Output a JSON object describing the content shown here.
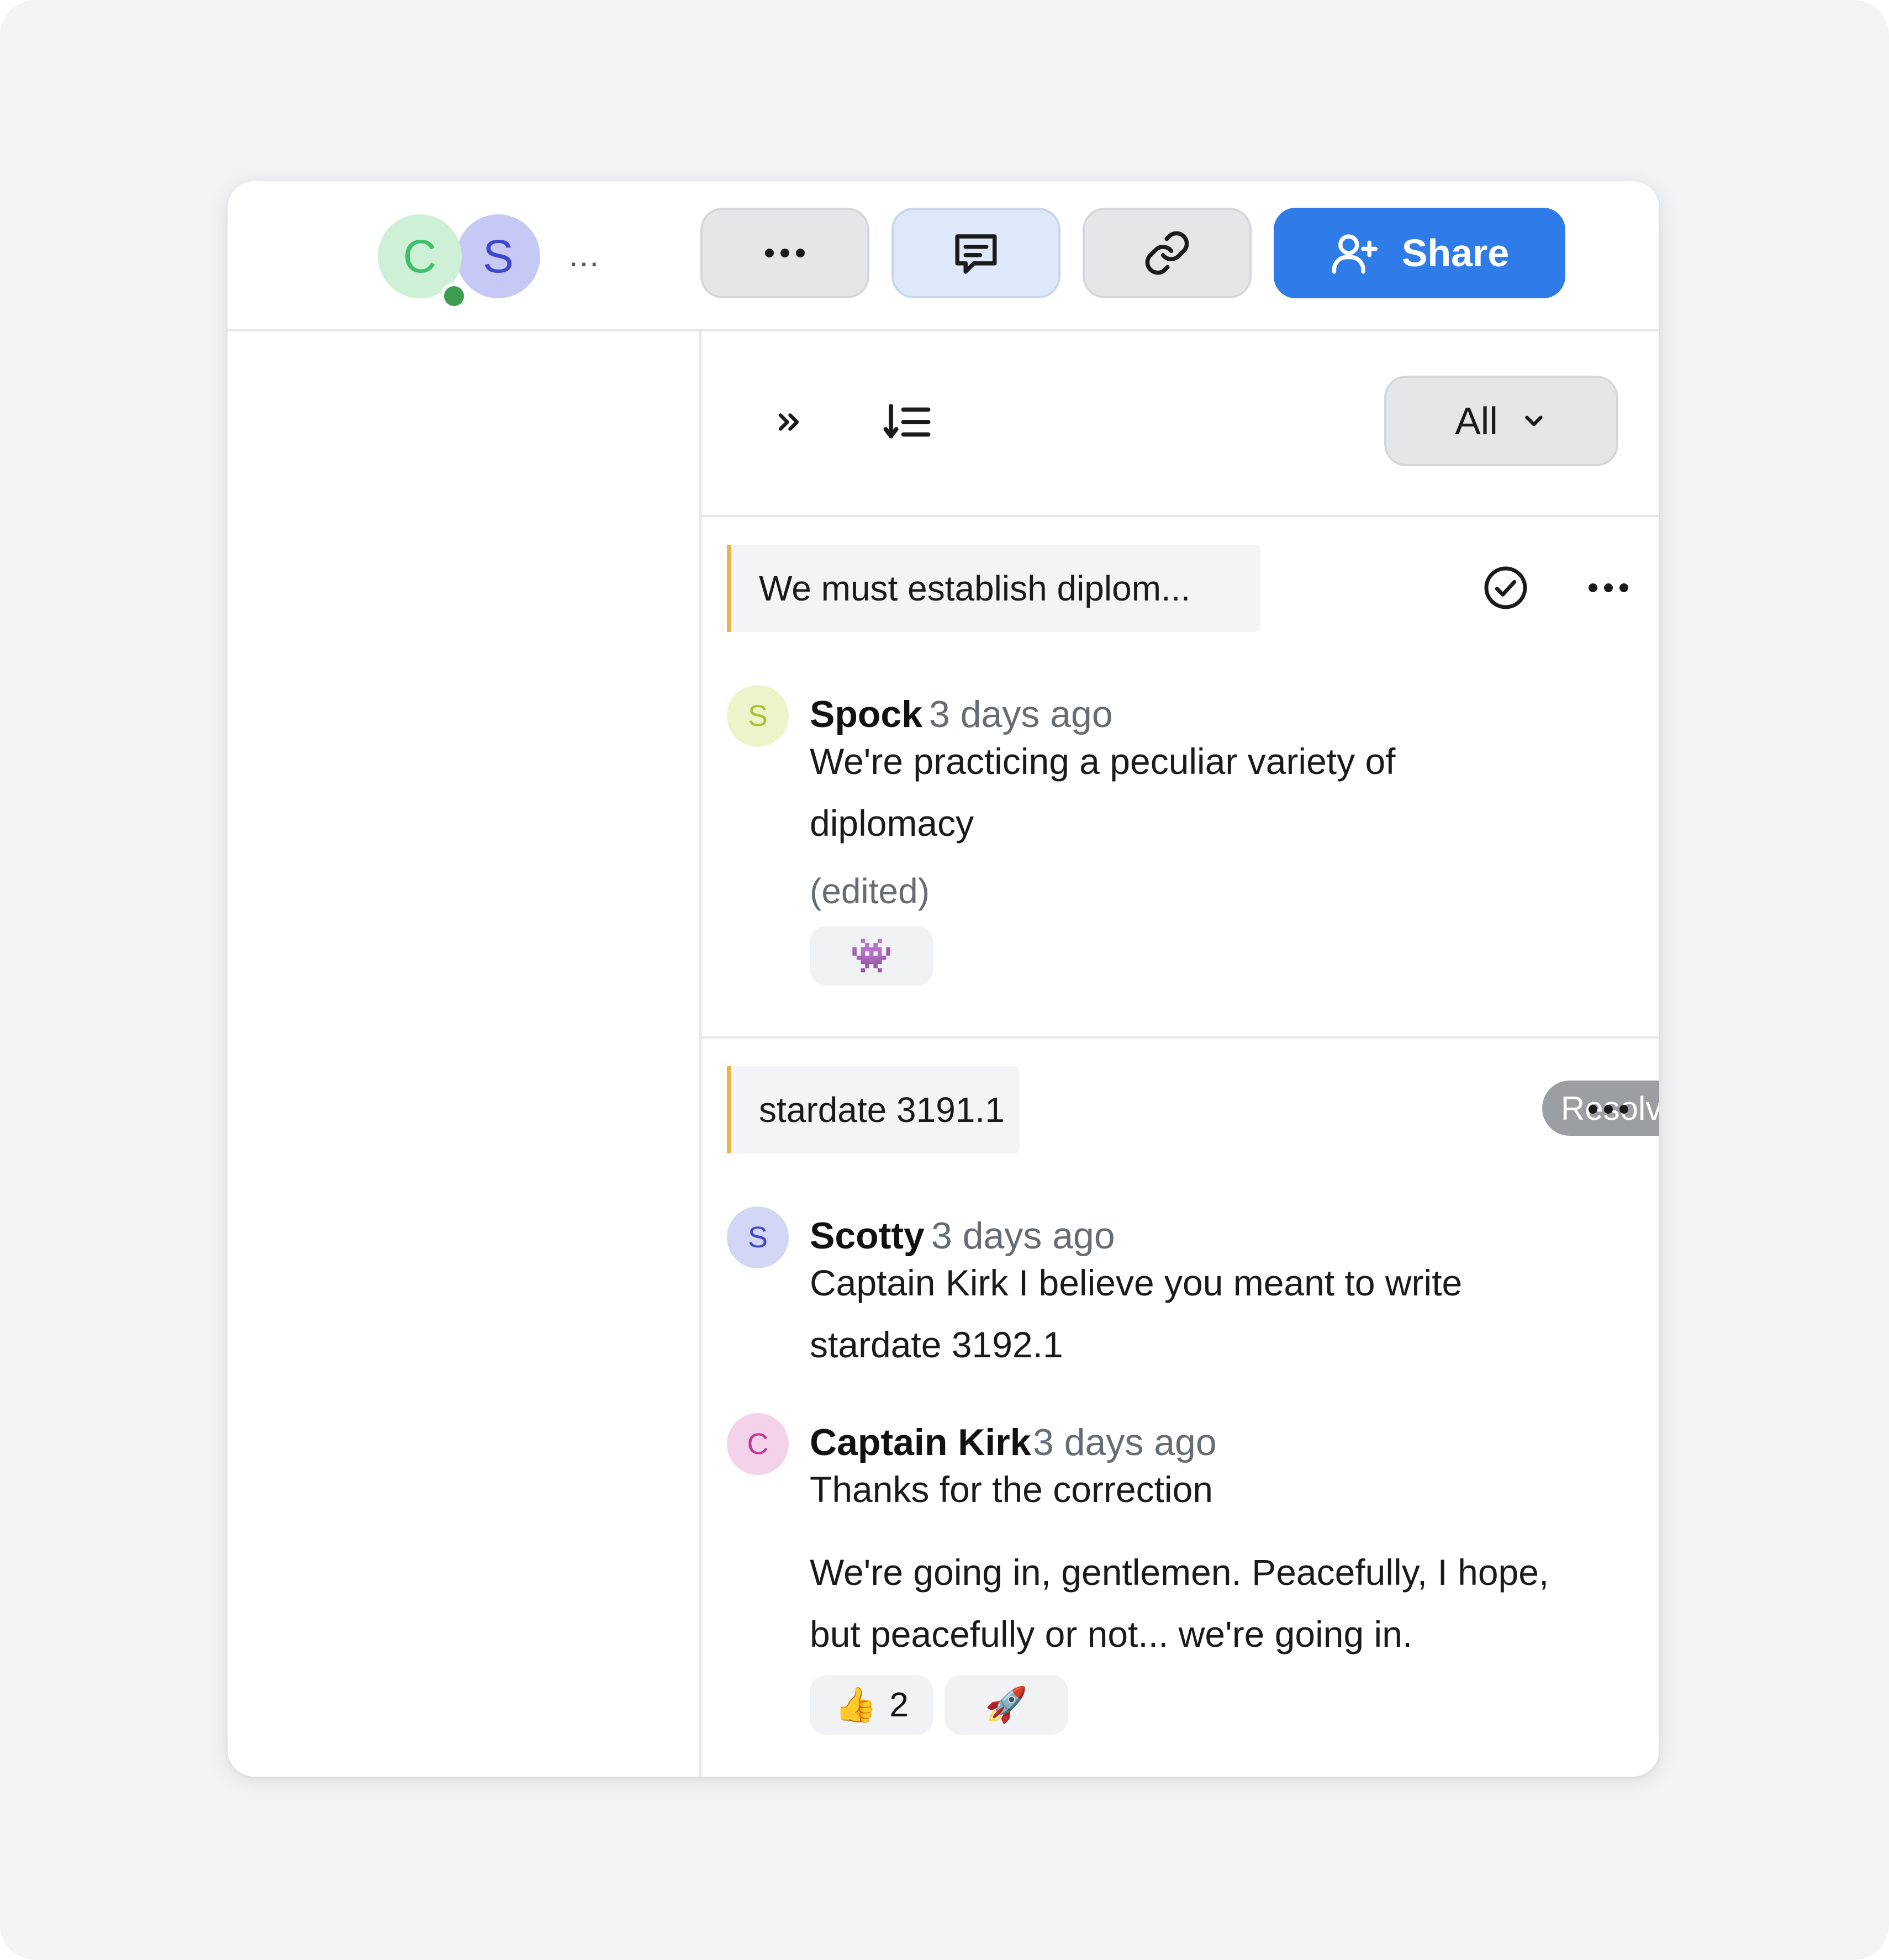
{
  "header": {
    "avatars": [
      {
        "initial": "C",
        "color": "#3fbf6c",
        "bg": "#cdf0d7",
        "online": true
      },
      {
        "initial": "S",
        "color": "#3e48cf",
        "bg": "#c5c9f3",
        "online": false
      }
    ],
    "more_avatars": "...",
    "more_button_icon": "more-horizontal-icon",
    "comments_button_icon": "comment-icon",
    "link_button_icon": "link-icon",
    "share_label": "Share",
    "share_icon": "add-user-icon",
    "share_color": "#2f7be8"
  },
  "panel": {
    "collapse_icon": "double-chevron-right-icon",
    "sort_icon": "sort-descending-icon",
    "filter": {
      "selected": "All",
      "icon": "chevron-down-icon"
    }
  },
  "threads": [
    {
      "quote": "We must establish diplom...",
      "status": "open",
      "resolve_icon": "check-circle-icon",
      "menu_icon": "more-horizontal-icon",
      "comments": [
        {
          "author": "Spock",
          "initial": "S",
          "avatar_bg": "#eef4c9",
          "avatar_color": "#a8c23a",
          "time": "3 days ago",
          "body_lines": [
            "We're practicing a peculiar variety of",
            "diplomacy"
          ],
          "edited": "(edited)",
          "reactions": [
            {
              "emoji": "👾",
              "count": ""
            }
          ]
        }
      ]
    },
    {
      "quote": "stardate 3191.1",
      "status": "Resolved",
      "menu_icon": "more-horizontal-icon",
      "comments": [
        {
          "author": "Scotty",
          "initial": "S",
          "avatar_bg": "#d4d6f5",
          "avatar_color": "#3e48cf",
          "time": "3 days ago",
          "body_lines": [
            "Captain Kirk I believe you meant to write",
            "stardate 3192.1"
          ]
        },
        {
          "author": "Captain Kirk",
          "initial": "C",
          "avatar_bg": "#f4d3ea",
          "avatar_color": "#c0399a",
          "time": "3 days ago",
          "body_lines": [
            "Thanks for the correction"
          ],
          "body2_lines": [
            "We're going in, gentlemen. Peacefully, I hope,",
            "but peacefully or not... we're going in."
          ],
          "reactions": [
            {
              "emoji": "👍",
              "count": "2"
            },
            {
              "emoji": "🚀",
              "count": ""
            }
          ]
        }
      ]
    }
  ]
}
